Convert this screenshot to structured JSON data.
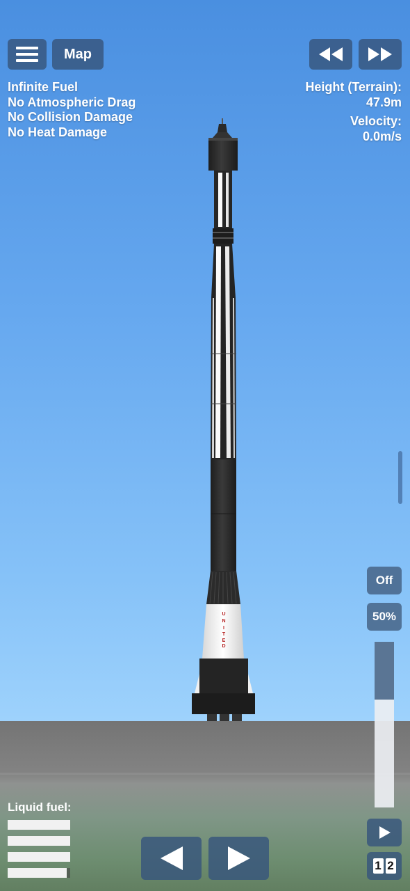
{
  "toolbar": {
    "menu_icon": "hamburger-menu-icon",
    "map_label": "Map",
    "rewind_icon": "rewind-icon",
    "fast_forward_icon": "fast-forward-icon"
  },
  "cheats": [
    "Infinite Fuel",
    "No Atmospheric Drag",
    "No Collision Damage",
    "No Heat Damage"
  ],
  "telemetry": {
    "height_label": "Height (Terrain):",
    "height_value": "47.9m",
    "velocity_label": "Velocity:",
    "velocity_value": "0.0m/s"
  },
  "controls": {
    "sas_label": "Off",
    "throttle_label": "50%",
    "throttle_fraction": 0.5,
    "play_icon": "play-icon",
    "stage_digits": [
      "1",
      "2"
    ],
    "left_icon": "rotate-left-icon",
    "right_icon": "rotate-right-icon"
  },
  "fuel": {
    "label": "Liquid fuel:",
    "tanks": [
      1.0,
      1.0,
      1.0,
      0.94
    ]
  },
  "rocket": {
    "lettering": "UNITED"
  },
  "colors": {
    "button_bg": "#37557d",
    "sky_top": "#4a8fe0",
    "sky_bottom": "#9ed2fc",
    "ground": "#7c7c7c",
    "rocket_black": "#2b2b2b",
    "rocket_white": "#f0f0f0",
    "lettering_red": "#b42020"
  }
}
